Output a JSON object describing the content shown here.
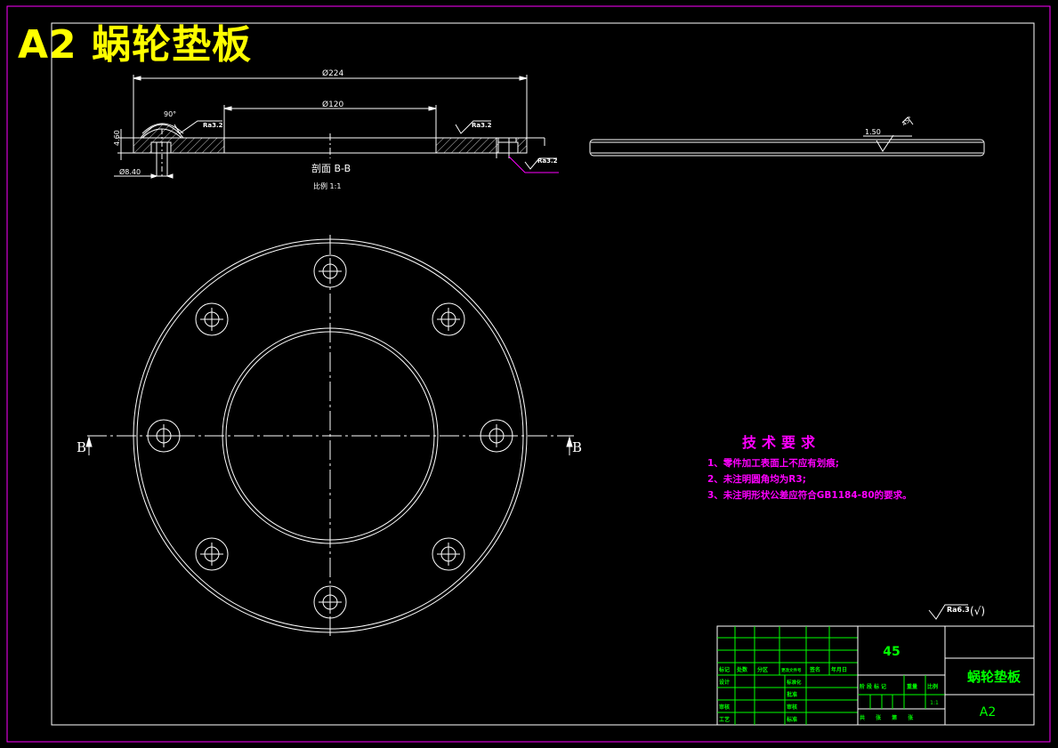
{
  "sheet": {
    "title": "A2 蜗轮垫板"
  },
  "section": {
    "dim_outer": "Ø224",
    "dim_inner": "Ø120",
    "dim_thickness": "4.60",
    "dim_hole": "Ø8.40",
    "angle": "90°",
    "roughness_left": "Ra3.2",
    "roughness_right": "Ra3.2",
    "roughness_bottom": "Ra3.2",
    "label": "剖面 B-B",
    "scale_label": "比例 1:1"
  },
  "side_view": {
    "dim_label": "1.50",
    "corner_mark": "45°"
  },
  "plan_view": {
    "section_mark_left": "B",
    "section_mark_right": "B"
  },
  "tech_requirements": {
    "title": "技术要求",
    "items": [
      "1、零件加工表面上不应有划痕;",
      "2、未注明圆角均为R3;",
      "3、未注明形状公差应符合GB1184-80的要求。"
    ]
  },
  "general_roughness": {
    "value": "Ra6.3",
    "suffix": "(√)"
  },
  "title_block": {
    "material": "45",
    "part_name": "蜗轮垫板",
    "drawing_no": "A2",
    "scale": "1:1",
    "row_headers": [
      "标记",
      "处数",
      "分区",
      "更改文件号",
      "签名",
      "年月日"
    ],
    "roles": [
      "设计",
      "审核",
      "工艺"
    ],
    "mid_labels": [
      "标准化",
      "批准",
      "审核",
      "标准"
    ],
    "stage_headers": [
      "阶段标记",
      "重量",
      "比例"
    ],
    "sheet_info": "共 张 第 张"
  },
  "colors": {
    "line": "#ffffff",
    "frame": "#ff00ff",
    "title": "#ffff00",
    "tech": "#ff00ff",
    "block_text": "#00ff00",
    "block_grid": "#00ff00",
    "symbol": "#ffffff"
  }
}
